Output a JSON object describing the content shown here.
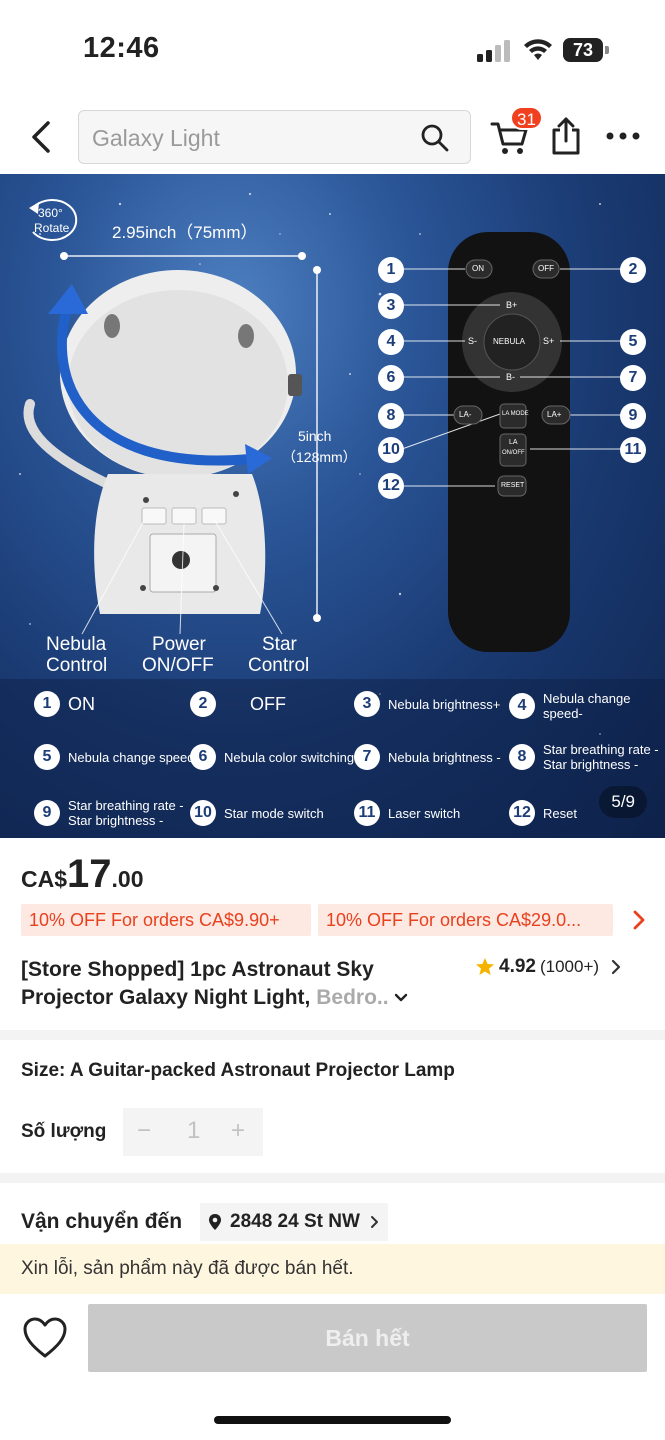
{
  "status_bar": {
    "time": "12:46",
    "battery": "73"
  },
  "nav": {
    "search_placeholder": "Galaxy Light",
    "cart_count": "31"
  },
  "image": {
    "rotate_label_line1": "360°",
    "rotate_label_line2": "Rotate",
    "width_dim": "2.95inch（75mm）",
    "height_dim_line1": "5inch",
    "height_dim_line2": "（128mm）",
    "nebula_control_line1": "Nebula",
    "nebula_control_line2": "Control",
    "power_line1": "Power",
    "power_line2": "ON/OFF",
    "star_control_line1": "Star",
    "star_control_line2": "Control",
    "remote_buttons": {
      "on": "ON",
      "off": "OFF",
      "b_plus": "B+",
      "s_minus": "S-",
      "nebula": "NEBULA",
      "s_plus": "S+",
      "b_minus": "B-",
      "la_minus": "LA-",
      "la_mode": "LA MODE",
      "la_plus": "LA+",
      "la_onoff_line1": "LA",
      "la_onoff_line2": "ON/OFF",
      "reset": "RESET"
    },
    "callout_numbers": [
      "1",
      "2",
      "3",
      "4",
      "5",
      "6",
      "7",
      "8",
      "9",
      "10",
      "11",
      "12"
    ],
    "legend": [
      {
        "num": "1",
        "text": "ON"
      },
      {
        "num": "2",
        "text": "OFF"
      },
      {
        "num": "3",
        "text": "Nebula brightness+"
      },
      {
        "num": "4",
        "text": "Nebula change speed-"
      },
      {
        "num": "5",
        "text": "Nebula change speed+"
      },
      {
        "num": "6",
        "text": "Nebula color switching+"
      },
      {
        "num": "7",
        "text": "Nebula brightness -"
      },
      {
        "num": "8",
        "text_line1": "Star breathing rate -",
        "text_line2": "Star brightness -"
      },
      {
        "num": "9",
        "text_line1": "Star breathing rate -",
        "text_line2": "Star brightness -"
      },
      {
        "num": "10",
        "text": "Star mode switch"
      },
      {
        "num": "11",
        "text": "Laser switch"
      },
      {
        "num": "12",
        "text": "Reset"
      }
    ],
    "counter": "5/9"
  },
  "price": {
    "currency": "CA$",
    "integer": "17",
    "decimal": ".00"
  },
  "coupons": [
    "10% OFF For orders CA$9.90+",
    "10% OFF For orders CA$29.0..."
  ],
  "product": {
    "title_main": "[Store Shopped] 1pc Astronaut Sky Projector Galaxy Night Light, ",
    "title_fade": "Bedro..",
    "rating": "4.92",
    "rating_count": "(1000+)"
  },
  "options": {
    "size_text": "Size: A Guitar-packed Astronaut Projector Lamp",
    "qty_label": "Số lượng",
    "qty_minus": "−",
    "qty_value": "1",
    "qty_plus": "+"
  },
  "shipping": {
    "label": "Vận chuyển đến",
    "address": "2848 24 St NW"
  },
  "notice": "Xin lỗi, sản phẩm này đã được bán hết.",
  "bottom_bar": {
    "buy_label": "Bán hết"
  }
}
